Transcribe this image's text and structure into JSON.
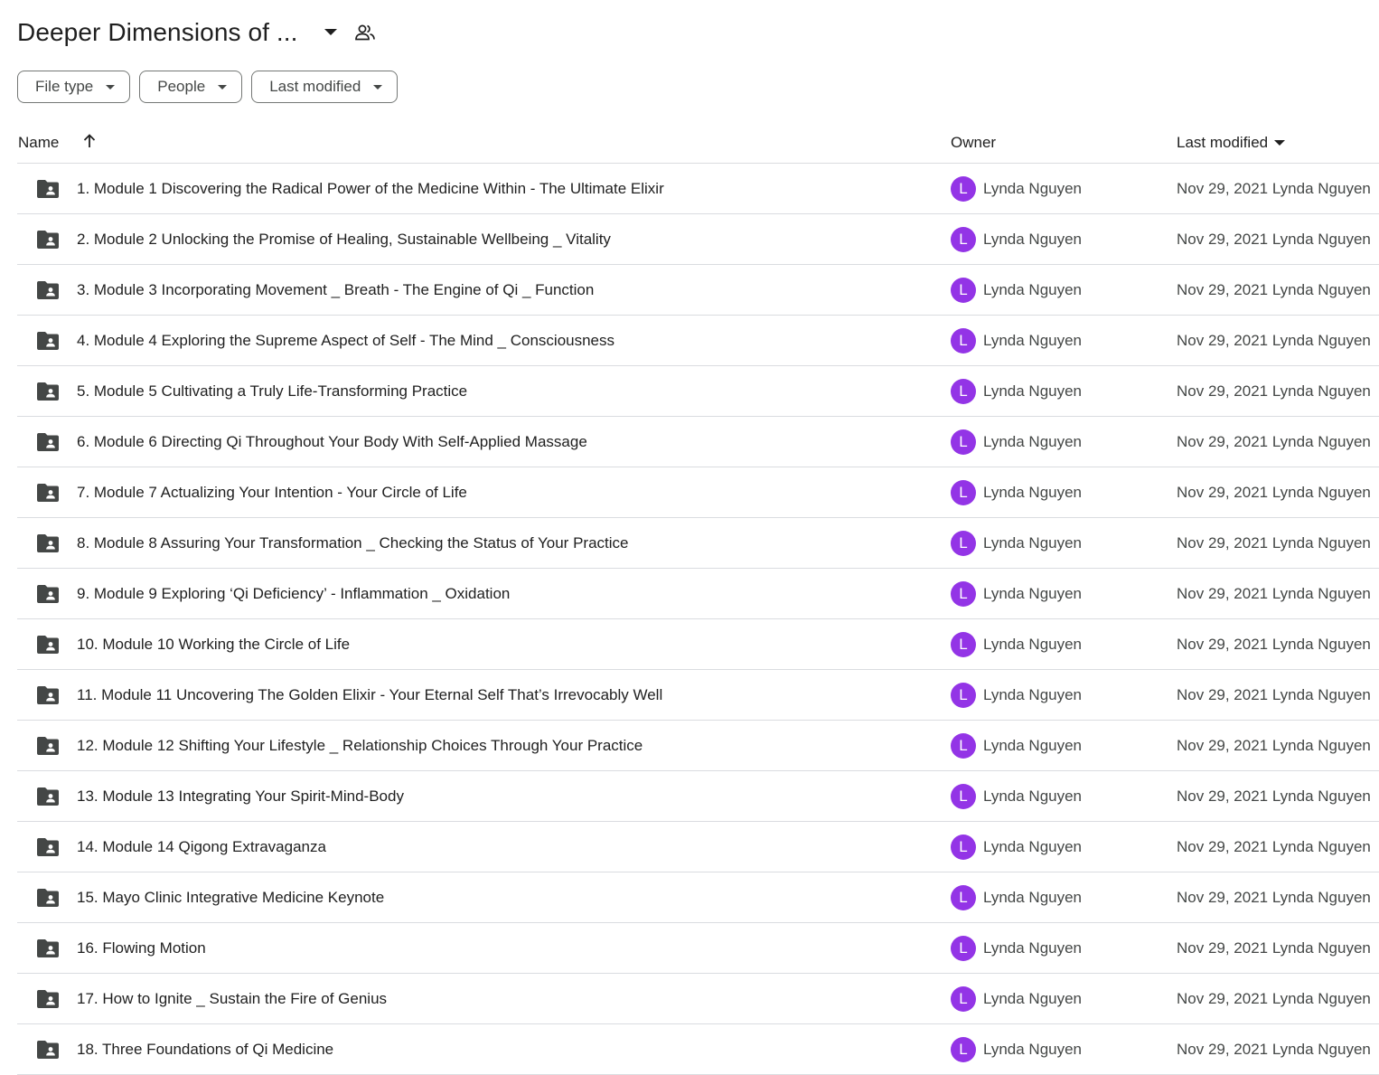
{
  "header": {
    "title": "Deeper Dimensions of ..."
  },
  "filters": [
    {
      "label": "File type"
    },
    {
      "label": "People"
    },
    {
      "label": "Last modified"
    }
  ],
  "columns": {
    "name": "Name",
    "owner": "Owner",
    "last_modified": "Last modified"
  },
  "avatar_color": "#9334e6",
  "rows": [
    {
      "name": "1.  Module 1 Discovering the Radical Power of the Medicine Within - The Ultimate Elixir",
      "owner_initial": "L",
      "owner": "Lynda Nguyen",
      "modified": "Nov 29, 2021 Lynda Nguyen"
    },
    {
      "name": "2. Module 2 Unlocking the Promise of Healing, Sustainable Wellbeing _ Vitality",
      "owner_initial": "L",
      "owner": "Lynda Nguyen",
      "modified": "Nov 29, 2021 Lynda Nguyen"
    },
    {
      "name": "3. Module 3 Incorporating Movement _ Breath - The Engine of Qi _ Function",
      "owner_initial": "L",
      "owner": "Lynda Nguyen",
      "modified": "Nov 29, 2021 Lynda Nguyen"
    },
    {
      "name": "4. Module 4 Exploring the Supreme Aspect of Self - The Mind _ Consciousness",
      "owner_initial": "L",
      "owner": "Lynda Nguyen",
      "modified": "Nov 29, 2021 Lynda Nguyen"
    },
    {
      "name": "5. Module 5 Cultivating a Truly Life-Transforming Practice",
      "owner_initial": "L",
      "owner": "Lynda Nguyen",
      "modified": "Nov 29, 2021 Lynda Nguyen"
    },
    {
      "name": "6.  Module 6 Directing Qi Throughout Your Body With Self-Applied Massage",
      "owner_initial": "L",
      "owner": "Lynda Nguyen",
      "modified": "Nov 29, 2021 Lynda Nguyen"
    },
    {
      "name": "7. Module 7 Actualizing Your Intention - Your Circle of Life",
      "owner_initial": "L",
      "owner": "Lynda Nguyen",
      "modified": "Nov 29, 2021 Lynda Nguyen"
    },
    {
      "name": "8. Module 8 Assuring Your Transformation _ Checking the Status of Your Practice",
      "owner_initial": "L",
      "owner": "Lynda Nguyen",
      "modified": "Nov 29, 2021 Lynda Nguyen"
    },
    {
      "name": "9. Module 9 Exploring ‘Qi Deficiency’ - Inflammation _ Oxidation",
      "owner_initial": "L",
      "owner": "Lynda Nguyen",
      "modified": "Nov 29, 2021 Lynda Nguyen"
    },
    {
      "name": "10. Module 10 Working the Circle of Life",
      "owner_initial": "L",
      "owner": "Lynda Nguyen",
      "modified": "Nov 29, 2021 Lynda Nguyen"
    },
    {
      "name": "11. Module 11 Uncovering The Golden Elixir - Your Eternal Self That’s Irrevocably Well",
      "owner_initial": "L",
      "owner": "Lynda Nguyen",
      "modified": "Nov 29, 2021 Lynda Nguyen"
    },
    {
      "name": "12. Module 12 Shifting Your Lifestyle _ Relationship Choices Through Your Practice",
      "owner_initial": "L",
      "owner": "Lynda Nguyen",
      "modified": "Nov 29, 2021 Lynda Nguyen"
    },
    {
      "name": "13. Module 13 Integrating Your Spirit-Mind-Body",
      "owner_initial": "L",
      "owner": "Lynda Nguyen",
      "modified": "Nov 29, 2021 Lynda Nguyen"
    },
    {
      "name": "14. Module 14 Qigong Extravaganza",
      "owner_initial": "L",
      "owner": "Lynda Nguyen",
      "modified": "Nov 29, 2021 Lynda Nguyen"
    },
    {
      "name": "15. Mayo Clinic Integrative Medicine Keynote",
      "owner_initial": "L",
      "owner": "Lynda Nguyen",
      "modified": "Nov 29, 2021 Lynda Nguyen"
    },
    {
      "name": "16. Flowing Motion",
      "owner_initial": "L",
      "owner": "Lynda Nguyen",
      "modified": "Nov 29, 2021 Lynda Nguyen"
    },
    {
      "name": "17. How to Ignite _ Sustain the Fire of Genius",
      "owner_initial": "L",
      "owner": "Lynda Nguyen",
      "modified": "Nov 29, 2021 Lynda Nguyen"
    },
    {
      "name": "18. Three Foundations of Qi Medicine",
      "owner_initial": "L",
      "owner": "Lynda Nguyen",
      "modified": "Nov 29, 2021 Lynda Nguyen"
    }
  ]
}
